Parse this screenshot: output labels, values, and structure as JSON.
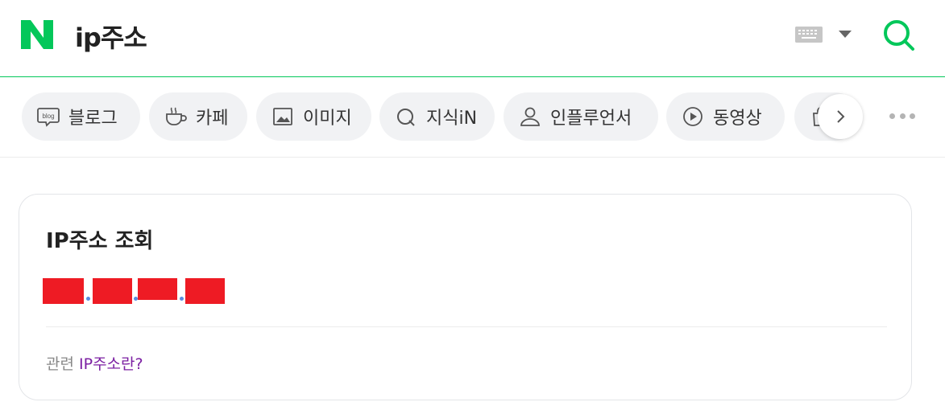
{
  "header": {
    "logo_letter": "N",
    "query": "ip주소",
    "brand_color": "#03c75a",
    "keyboard_icon": "keyboard-icon",
    "dropdown_icon": "caret-down-icon",
    "search_icon": "search-icon"
  },
  "tabs": [
    {
      "label": "블로그",
      "icon": "blog-icon"
    },
    {
      "label": "카페",
      "icon": "cafe-cup-icon"
    },
    {
      "label": "이미지",
      "icon": "image-icon"
    },
    {
      "label": "지식iN",
      "icon": "kin-q-icon"
    },
    {
      "label": "인플루언서",
      "icon": "person-icon"
    },
    {
      "label": "동영상",
      "icon": "play-circle-icon"
    },
    {
      "label": "",
      "icon": "shopping-bag-icon"
    }
  ],
  "tab_nav": {
    "next_icon": "chevron-right-icon",
    "more_icon": "more-dots-icon"
  },
  "card": {
    "title": "IP주소 조회",
    "ip_redacted_color": "#ee1b24",
    "related_prefix": "관련",
    "related_link": "IP주소란?"
  }
}
